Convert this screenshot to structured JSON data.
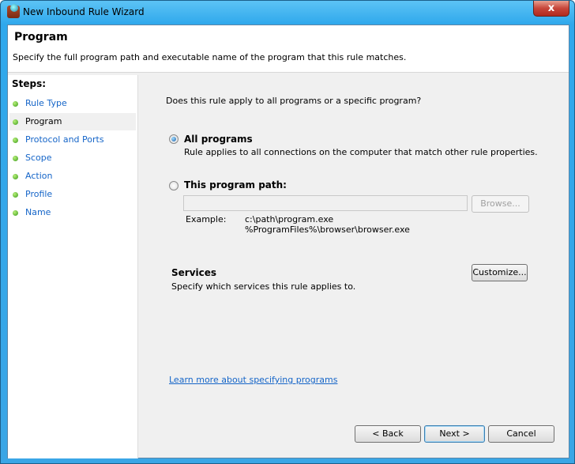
{
  "window": {
    "title": "New Inbound Rule Wizard",
    "close_label": "x"
  },
  "header": {
    "title": "Program",
    "subtitle": "Specify the full program path and executable name of the program that this rule matches."
  },
  "sidebar": {
    "heading": "Steps:",
    "items": [
      {
        "label": "Rule Type"
      },
      {
        "label": "Program",
        "current": true
      },
      {
        "label": "Protocol and Ports"
      },
      {
        "label": "Scope"
      },
      {
        "label": "Action"
      },
      {
        "label": "Profile"
      },
      {
        "label": "Name"
      }
    ]
  },
  "main": {
    "question": "Does this rule apply to all programs or a specific program?",
    "all_programs": {
      "label": "All programs",
      "description": "Rule applies to all connections on the computer that match other rule properties.",
      "selected": true
    },
    "program_path": {
      "label": "This program path:",
      "value": "",
      "selected": false,
      "browse_label": "Browse..."
    },
    "example": {
      "label": "Example:",
      "line1": "c:\\path\\program.exe",
      "line2": "%ProgramFiles%\\browser\\browser.exe"
    },
    "services": {
      "title": "Services",
      "description": "Specify which services this rule applies to.",
      "customize_label": "Customize..."
    },
    "learn_more": "Learn more about specifying programs"
  },
  "footer": {
    "back": "< Back",
    "next": "Next >",
    "cancel": "Cancel"
  }
}
